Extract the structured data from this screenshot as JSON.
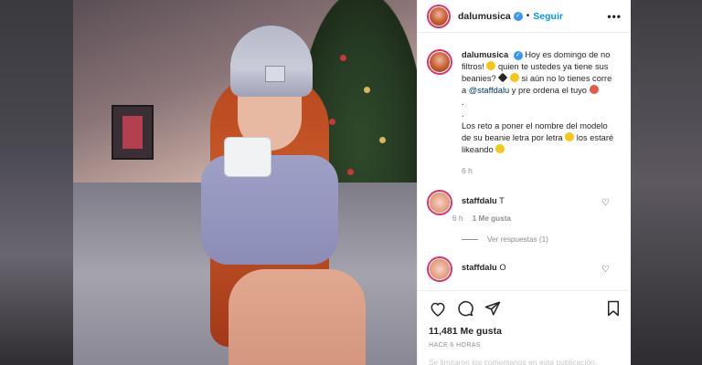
{
  "post": {
    "username": "dalumusica",
    "follow_label": "Seguir",
    "more_label": "•••",
    "caption": {
      "username": "dalumusica",
      "line1": "Hoy es domingo de no filtros!",
      "line2": "quien te ustedes ya tiene sus beanies?",
      "line3": "si aún no lo tienes corre a",
      "mention": "@staffdalu",
      "line4": "y pre ordena el tuyo",
      "dot1": ".",
      "dot2": ".",
      "line5": "Los reto a poner el nombre del modelo de su beanie letra por letra",
      "line6": "los estaré likeando",
      "time": "6 h"
    },
    "comments": [
      {
        "username": "staffdalu",
        "text": "T",
        "time": "6 h",
        "likes": "1 Me gusta",
        "replies": "Ver respuestas (1)"
      },
      {
        "username": "staffdalu",
        "text": "O"
      }
    ],
    "likes": "11,481 Me gusta",
    "posted": "HACE 6 HORAS",
    "comments_disabled": "Se limitaron los comentarios en esta publicación."
  },
  "colors": {
    "follow": "#0095f6",
    "verified": "#3897f0",
    "story_ring": "#e1306c"
  },
  "icons": [
    "heart-icon",
    "comment-icon",
    "share-icon",
    "bookmark-icon",
    "verified-badge-icon",
    "more-options-icon"
  ]
}
